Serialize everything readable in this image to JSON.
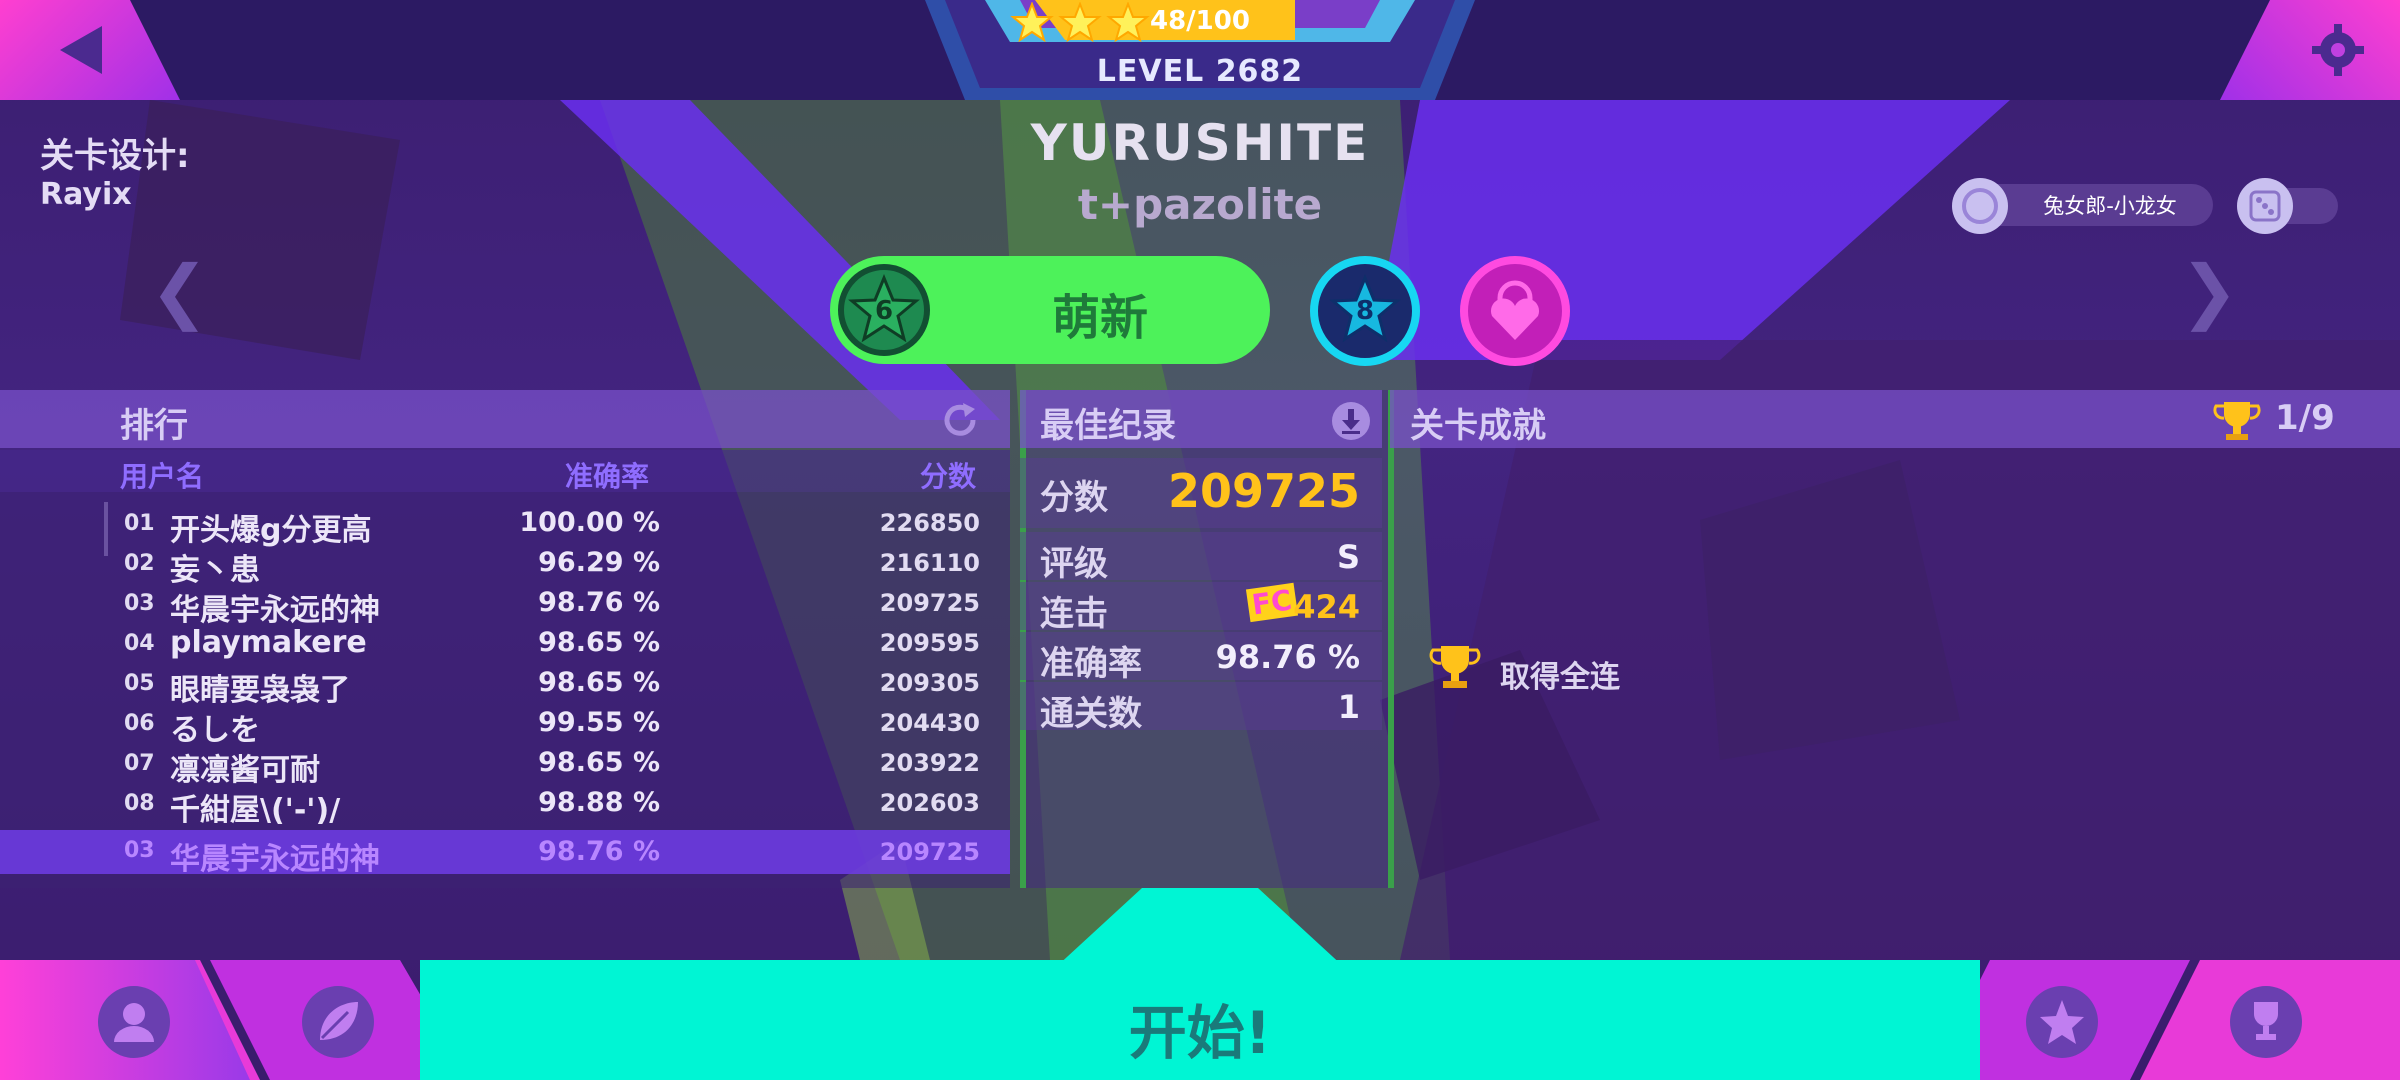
{
  "header": {
    "back_icon": "back-arrow-icon",
    "settings_icon": "gear-icon",
    "stars_progress": "48/100",
    "stars_filled": 3,
    "level_label": "LEVEL",
    "level_value": "2682"
  },
  "song": {
    "designer_label": "关卡设计:",
    "designer_name": "Rayix",
    "title": "YURUSHITE",
    "artist": "t+pazolite"
  },
  "skin": {
    "character_name": "兔女郎-小龙女",
    "character_icon": "character-icon",
    "dice_icon": "dice-icon"
  },
  "difficulties": [
    {
      "level": "6",
      "label": "萌新",
      "color": "#4df25a",
      "selected": true
    },
    {
      "level": "8",
      "label": "",
      "color": "#17d7f2",
      "selected": false
    },
    {
      "level": "",
      "label": "",
      "color": "#ff4ae0",
      "locked": true
    }
  ],
  "leaderboard": {
    "title": "排行",
    "refresh_icon": "refresh-icon",
    "col_user": "用户名",
    "col_accuracy": "准确率",
    "col_score": "分数",
    "rows": [
      {
        "rank": "01",
        "name": "开头爆g分更高",
        "accuracy": "100.00 %",
        "score": "226850"
      },
      {
        "rank": "02",
        "name": "妄丶患",
        "accuracy": "96.29 %",
        "score": "216110"
      },
      {
        "rank": "03",
        "name": "华晨宇永远的神",
        "accuracy": "98.76 %",
        "score": "209725"
      },
      {
        "rank": "04",
        "name": "playmakere",
        "accuracy": "98.65 %",
        "score": "209595"
      },
      {
        "rank": "05",
        "name": "眼睛要袅袅了",
        "accuracy": "98.65 %",
        "score": "209305"
      },
      {
        "rank": "06",
        "name": "るしを",
        "accuracy": "99.55 %",
        "score": "204430"
      },
      {
        "rank": "07",
        "name": "凛凛酱可耐",
        "accuracy": "98.65 %",
        "score": "203922"
      },
      {
        "rank": "08",
        "name": "千紺屋\\('-')/",
        "accuracy": "98.88 %",
        "score": "202603"
      }
    ],
    "mine": {
      "rank": "03",
      "name": "华晨宇永远的神",
      "accuracy": "98.76 %",
      "score": "209725"
    }
  },
  "best_record": {
    "title": "最佳纪录",
    "download_icon": "download-icon",
    "score_label": "分数",
    "score_value": "209725",
    "grade_label": "评级",
    "grade_value": "S",
    "combo_label": "连击",
    "combo_badge": "FC",
    "combo_value": "424",
    "accuracy_label": "准确率",
    "accuracy_value": "98.76 %",
    "clears_label": "通关数",
    "clears_value": "1"
  },
  "achievements": {
    "title": "关卡成就",
    "trophy_icon": "trophy-icon",
    "progress": "1/9",
    "items": [
      {
        "label": "取得全连",
        "icon": "trophy-icon"
      }
    ]
  },
  "footer": {
    "start_label": "开始!",
    "start_color": "#00f5d4",
    "tabs": [
      "profile-icon",
      "leaf-icon",
      "star-icon",
      "trophy-icon"
    ]
  }
}
